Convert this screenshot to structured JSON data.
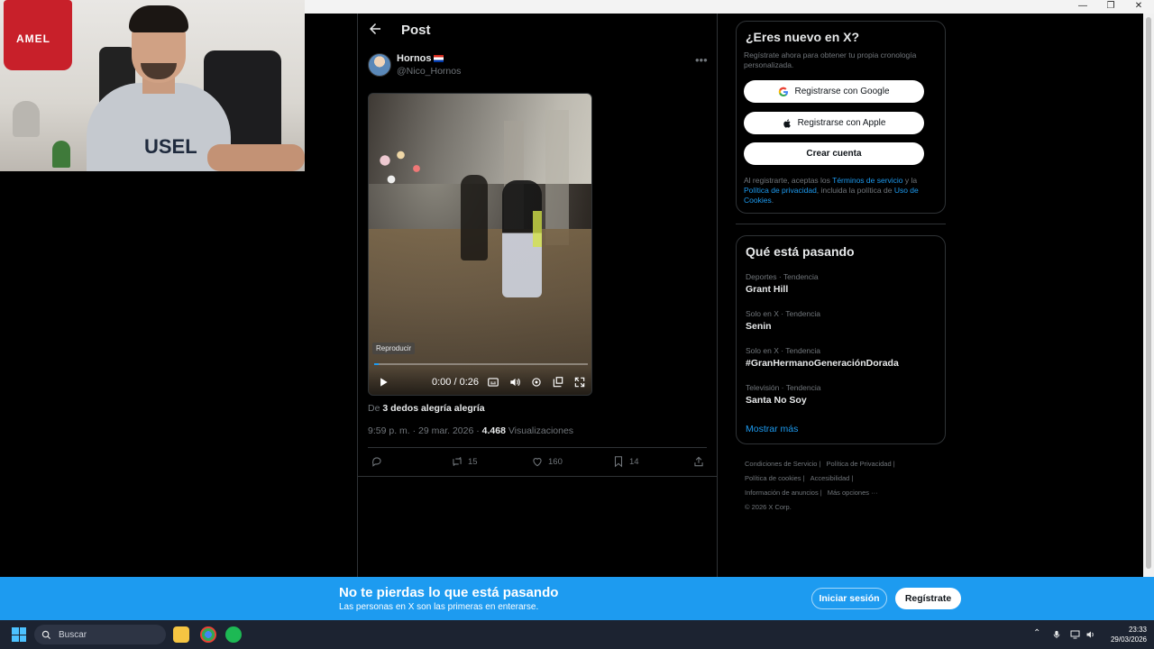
{
  "browser": {
    "minimize": "—",
    "restore": "❐",
    "close": "✕"
  },
  "post": {
    "header_title": "Post",
    "author_name": "Hornos",
    "author_handle": "@Nico_Hornos",
    "video": {
      "badge": "Reproducir",
      "time": "0:00 / 0:26",
      "progress": 0.02
    },
    "source_prefix": "De",
    "source_name": "3 dedos alegría alegría",
    "timestamp": "9:59 p. m. · 29 mar. 2026 ·",
    "views_count": "4.468",
    "views_label": "Visualizaciones",
    "actions": {
      "retweets": "15",
      "likes": "160",
      "bookmarks": "14"
    }
  },
  "signup": {
    "title": "¿Eres nuevo en X?",
    "subtitle": "Regístrate ahora para obtener tu propia cronología personalizada.",
    "google_label": "Registrarse con Google",
    "apple_label": "Registrarse con Apple",
    "create_label": "Crear cuenta",
    "legal_1": "Al registrarte, aceptas los",
    "legal_terms": "Términos de servicio",
    "legal_2": "y la",
    "legal_privacy": "Política de privacidad",
    "legal_3": ", incluida la política de",
    "legal_cookies": "Uso de Cookies",
    "legal_4": "."
  },
  "trends": {
    "title": "Qué está pasando",
    "items": [
      {
        "meta": "Deportes · Tendencia",
        "name": "Grant Hill"
      },
      {
        "meta": "Solo en X · Tendencia",
        "name": "Senin"
      },
      {
        "meta": "Solo en X · Tendencia",
        "name": "#GranHermanoGeneraciónDorada"
      },
      {
        "meta": "Televisión · Tendencia",
        "name": "Santa No Soy"
      }
    ],
    "show_more": "Mostrar más"
  },
  "footer": {
    "links": [
      "Condiciones de Servicio |",
      "Política de Privacidad |",
      "Política de cookies |",
      "Accesibilidad |",
      "Información de anuncios |",
      "Más opciones ···"
    ],
    "copyright": "© 2026 X Corp."
  },
  "banner": {
    "title": "No te pierdas lo que está pasando",
    "subtitle": "Las personas en X son las primeras en enterarse.",
    "login_label": "Iniciar sesión",
    "register_label": "Regístrate"
  },
  "taskbar": {
    "search_placeholder": "Buscar",
    "time": "23:33",
    "date": "29/03/2026"
  },
  "webcam": {
    "jersey_text": "AMEL",
    "shirt_text": "USEL"
  },
  "colors": {
    "accent": "#1d9bf0",
    "background": "#000000",
    "border": "#2f3336",
    "muted": "#71767b"
  }
}
